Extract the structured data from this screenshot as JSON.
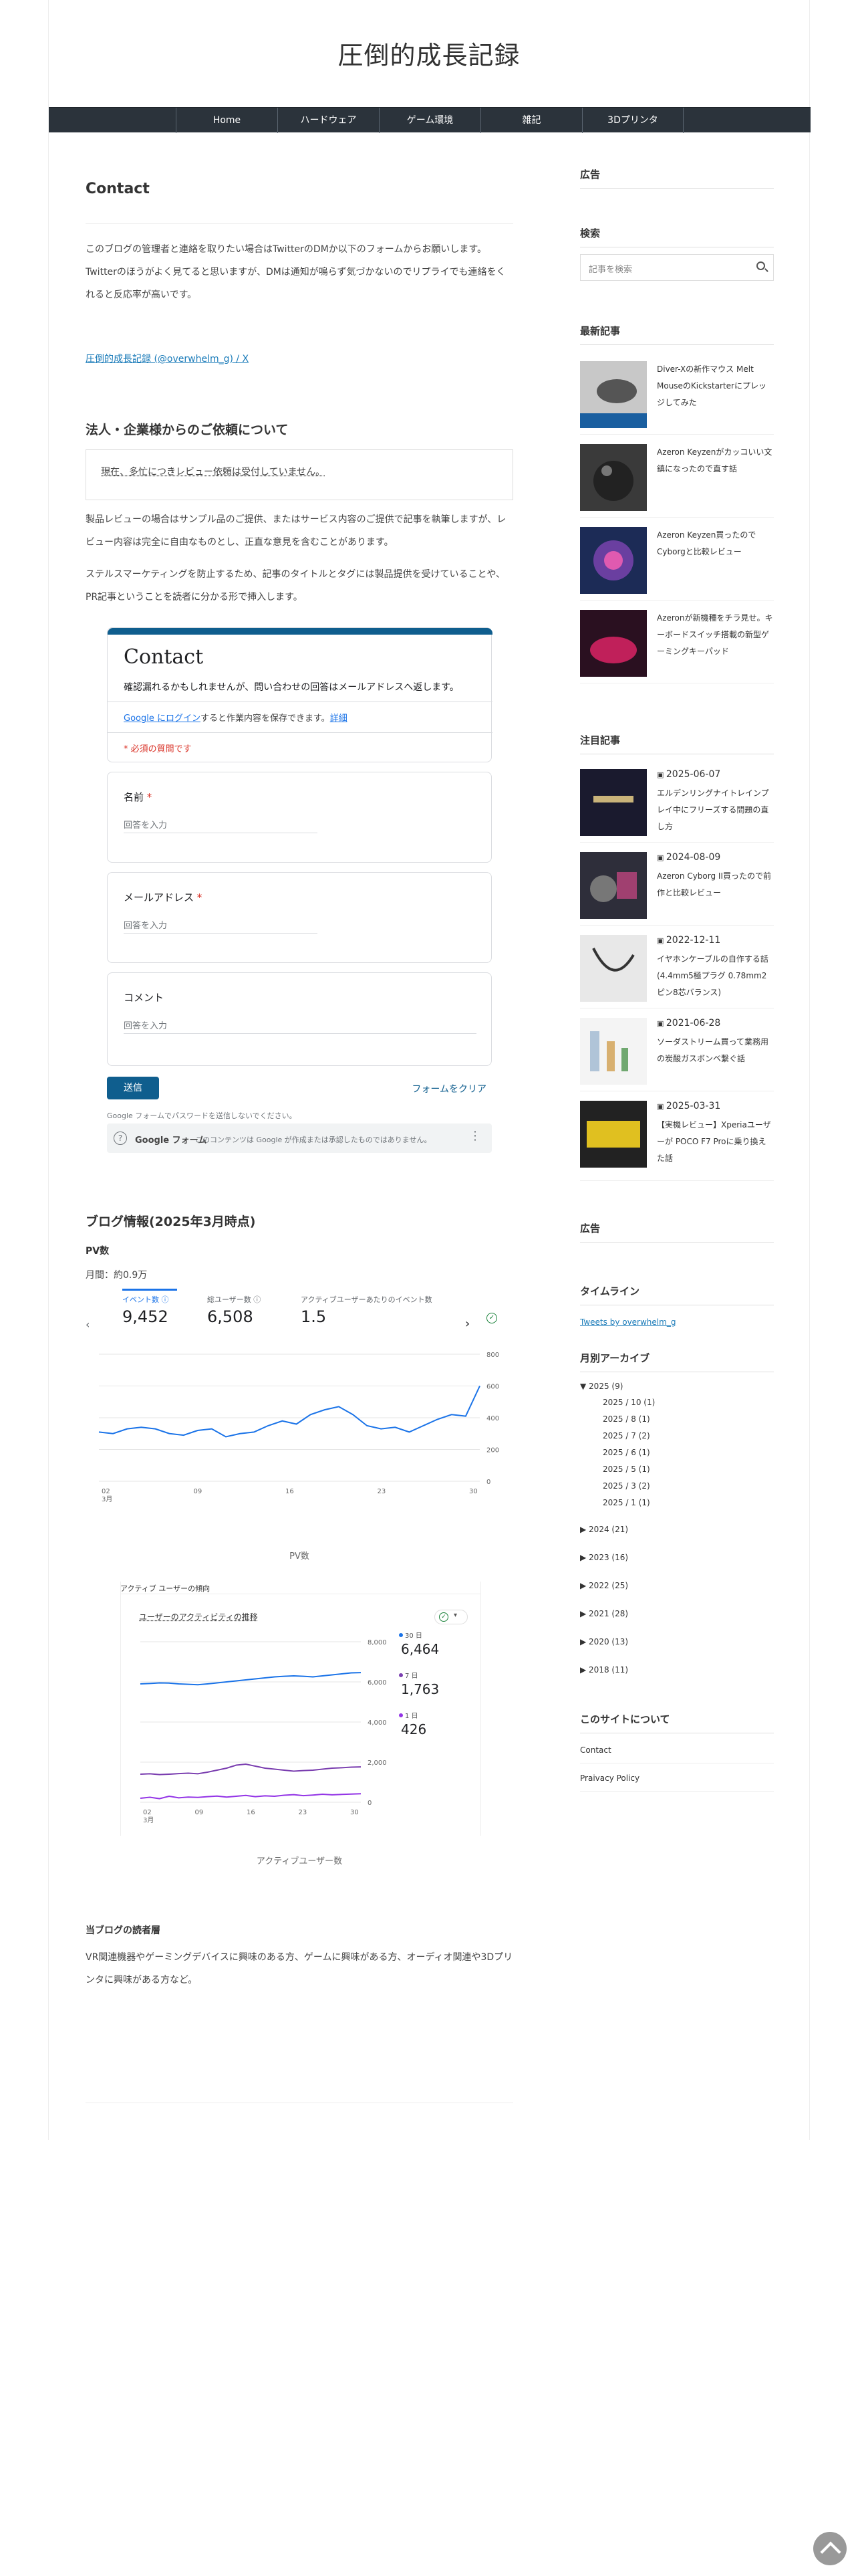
{
  "site": {
    "title": "圧倒的成長記録"
  },
  "nav": {
    "items": [
      "Home",
      "ハードウェア",
      "ゲーム環境",
      "雑記",
      "3Dプリンタ"
    ]
  },
  "entry": {
    "title": "Contact",
    "intro": "このブログの管理者と連絡を取りたい場合はTwitterのDMか以下のフォームからお願いします。Twitterのほうがよく見てると思いますが、DMは通知が鳴らず気づかないのでリプライでも連絡をくれると反応率が高いです。",
    "twitter_link": "圧倒的成長記録 (@overwhelm_g) / X",
    "corp_heading": "法人・企業様からのご依頼について",
    "notice": "現在、多忙につきレビュー依頼は受付していません。",
    "corp_p1": "製品レビューの場合はサンプル品のご提供、またはサービス内容のご提供で記事を執筆しますが、レビュー内容は完全に自由なものとし、正直な意見を含むことがあります。",
    "corp_p2": "ステルスマーケティングを防止するため、記事のタイトルとタグには製品提供を受けていることや、PR記事ということを読者に分かる形で挿入します。"
  },
  "form": {
    "title": "Contact",
    "description": "確認漏れるかもしれませんが、問い合わせの回答はメールアドレスへ返します。",
    "login_link": "Google にログイン",
    "login_text": "すると作業内容を保存できます。",
    "login_detail": "詳細",
    "required_note": "* 必須の質問です",
    "q_name": "名前",
    "q_email": "メールアドレス",
    "q_comment": "コメント",
    "required_star": "*",
    "answer_placeholder": "回答を入力",
    "submit": "送信",
    "clear": "フォームをクリア",
    "password_note": "Google フォームでパスワードを送信しないでください。",
    "footer_brand": "Google フォーム",
    "footer_disclaimer": "このコンテンツは Google が作成または承認したものではありません。",
    "help_icon": "?",
    "menu_icon": "⋮"
  },
  "blog_info": {
    "heading": "ブログ情報(2025年3月時点)",
    "pv_heading": "PV数",
    "pv_monthly": "月間：約0.9万",
    "chart1_caption": "PV数",
    "chart2_caption": "アクティブユーザー数",
    "readers_heading": "当ブログの読者層",
    "readers_text": "VR関連機器やゲーミングデバイスに興味のある方、ゲームに興味がある方、オーディオ関連や3Dプリンタに興味がある方など。"
  },
  "chart_data": [
    {
      "type": "line",
      "title": "",
      "kpis": [
        {
          "label": "イベント数 ⓘ",
          "value": "9,452"
        },
        {
          "label": "総ユーザー数 ⓘ",
          "value": "6,508"
        },
        {
          "label": "アクティブユーザーあたりのイベント数",
          "value": "1.5"
        }
      ],
      "x_ticks": [
        "02\n3月",
        "09",
        "16",
        "23",
        "30"
      ],
      "ylim": [
        0,
        800
      ],
      "y_ticks": [
        0,
        200,
        400,
        600,
        800
      ],
      "series": [
        {
          "values": [
            310,
            300,
            330,
            340,
            330,
            300,
            290,
            320,
            330,
            280,
            300,
            310,
            350,
            380,
            360,
            420,
            450,
            470,
            420,
            350,
            330,
            340,
            310,
            350,
            390,
            420,
            410,
            600
          ]
        }
      ],
      "color": "#1a73e8"
    },
    {
      "type": "line",
      "title": "ユーザーのアクティビティの推移",
      "header": "アクティブ ユーザーの傾向",
      "x_ticks": [
        "02\n3月",
        "09",
        "16",
        "23",
        "30"
      ],
      "ylim": [
        0,
        8000
      ],
      "y_ticks": [
        0,
        2000,
        4000,
        6000,
        8000
      ],
      "series": [
        {
          "name": "30 日",
          "value_label": "6,464",
          "values": [
            5900,
            5920,
            5950,
            5940,
            5900,
            5880,
            5860,
            5900,
            5950,
            6000,
            6050,
            6100,
            6150,
            6200,
            6250,
            6280,
            6300,
            6280,
            6250,
            6300,
            6350,
            6400,
            6450,
            6464
          ],
          "color": "#1a73e8"
        },
        {
          "name": "7 日",
          "value_label": "1,763",
          "values": [
            1400,
            1420,
            1380,
            1400,
            1430,
            1450,
            1420,
            1500,
            1600,
            1700,
            1850,
            1900,
            1800,
            1700,
            1650,
            1600,
            1550,
            1580,
            1600,
            1650,
            1700,
            1720,
            1750,
            1763
          ],
          "color": "#7b3fb0"
        },
        {
          "name": "1 日",
          "value_label": "426",
          "values": [
            200,
            250,
            180,
            300,
            220,
            260,
            240,
            280,
            310,
            260,
            300,
            340,
            280,
            320,
            300,
            350,
            380,
            330,
            360,
            400,
            370,
            390,
            410,
            426
          ],
          "color": "#9334e6"
        }
      ]
    }
  ],
  "sidebar": {
    "ad_title": "広告",
    "search_title": "検索",
    "search_placeholder": "記事を検索",
    "recent_title": "最新記事",
    "recent": [
      "Diver-Xの新作マウス Melt MouseのKickstarterにプレッジしてみた",
      "Azeron Keyzenがカッコいい文鎮になったので直す話",
      "Azeron Keyzen買ったのでCyborgと比較レビュー",
      "Azeronが新機種をチラ見せ。キーボードスイッチ搭載の新型ゲーミングキーパッド"
    ],
    "featured_title": "注目記事",
    "featured": [
      {
        "date": "2025-06-07",
        "title": "エルデンリングナイトレインプレイ中にフリーズする問題の直し方"
      },
      {
        "date": "2024-08-09",
        "title": "Azeron Cyborg II買ったので前作と比較レビュー"
      },
      {
        "date": "2022-12-11",
        "title": "イヤホンケーブルの自作する話 (4.4mm5極プラグ 0.78mm2ピン8芯バランス)"
      },
      {
        "date": "2021-06-28",
        "title": "ソーダストリーム買って業務用の炭酸ガスボンベ繋ぐ話"
      },
      {
        "date": "2025-03-31",
        "title": "【実機レビュー】Xperiaユーザーが POCO F7 Proに乗り換えた話"
      }
    ],
    "ad_title2": "広告",
    "timeline_title": "タイムライン",
    "timeline_link": "Tweets by overwhelm_g",
    "archive_title": "月別アーカイブ",
    "archive_open": "▼ 2025 (9)",
    "archive_months": [
      "2025 / 10 (1)",
      "2025 / 8 (1)",
      "2025 / 7 (2)",
      "2025 / 6 (1)",
      "2025 / 5 (1)",
      "2025 / 3 (2)",
      "2025 / 1 (1)"
    ],
    "archive_years": [
      "▶ 2024 (21)",
      "▶ 2023 (16)",
      "▶ 2022 (25)",
      "▶ 2021 (28)",
      "▶ 2020 (13)",
      "▶ 2018 (11)"
    ],
    "about_title": "このサイトについて",
    "about_links": [
      "Contact",
      "Praivacy Policy"
    ]
  }
}
